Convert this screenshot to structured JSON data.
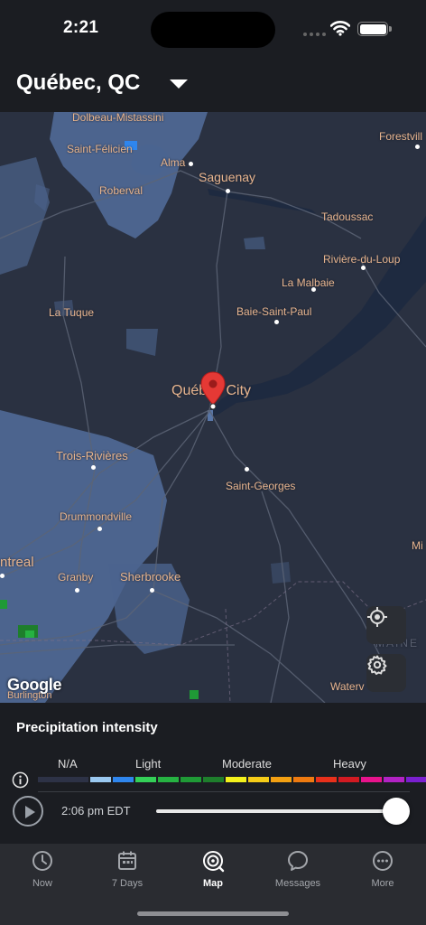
{
  "status_bar": {
    "time": "2:21"
  },
  "header": {
    "location": "Québec, QC"
  },
  "map": {
    "labels": {
      "dolbeau": "Dolbeau-Mistassini",
      "forestville": "Forestvill",
      "saint_felicien": "Saint-Félicien",
      "alma": "Alma",
      "saguenay": "Saguenay",
      "roberval": "Roberval",
      "tadoussac": "Tadoussac",
      "riviere_du_loup": "Rivière-du-Loup",
      "la_malbaie": "La Malbaie",
      "la_tuque": "La Tuque",
      "baie_saint_paul": "Baie-Saint-Paul",
      "quebec_city": "Québec City",
      "trois_rivieres": "Trois-Rivières",
      "saint_georges": "Saint-Georges",
      "drummondville": "Drummondville",
      "montreal": "ntreal",
      "granby": "Granby",
      "sherbrooke": "Sherbrooke",
      "mi": "Mi",
      "maine": "MAINE",
      "burlington": "Burlington",
      "waterv": "Waterv"
    },
    "attribution": "Google"
  },
  "precipitation": {
    "title": "Precipitation intensity",
    "scale_labels": {
      "na": "N/A",
      "light": "Light",
      "moderate": "Moderate",
      "heavy": "Heavy"
    },
    "scale_colors": [
      "#9ac8f0",
      "#2f86ee",
      "#34d058",
      "#26b242",
      "#1f9a36",
      "#1e7e2c",
      "#f4f21c",
      "#f5cc18",
      "#f3a012",
      "#ee7a10",
      "#e8301b",
      "#d21a22",
      "#e8138c",
      "#b222c4",
      "#7a1fd0"
    ],
    "time": "2:06 pm EDT",
    "slider_position": 1.0
  },
  "tabbar": {
    "tabs": [
      {
        "label": "Now",
        "icon": "clock-icon"
      },
      {
        "label": "7 Days",
        "icon": "calendar-icon"
      },
      {
        "label": "Map",
        "icon": "map-radar-icon",
        "active": true
      },
      {
        "label": "Messages",
        "icon": "chat-bubble-icon"
      },
      {
        "label": "More",
        "icon": "more-icon"
      }
    ]
  }
}
